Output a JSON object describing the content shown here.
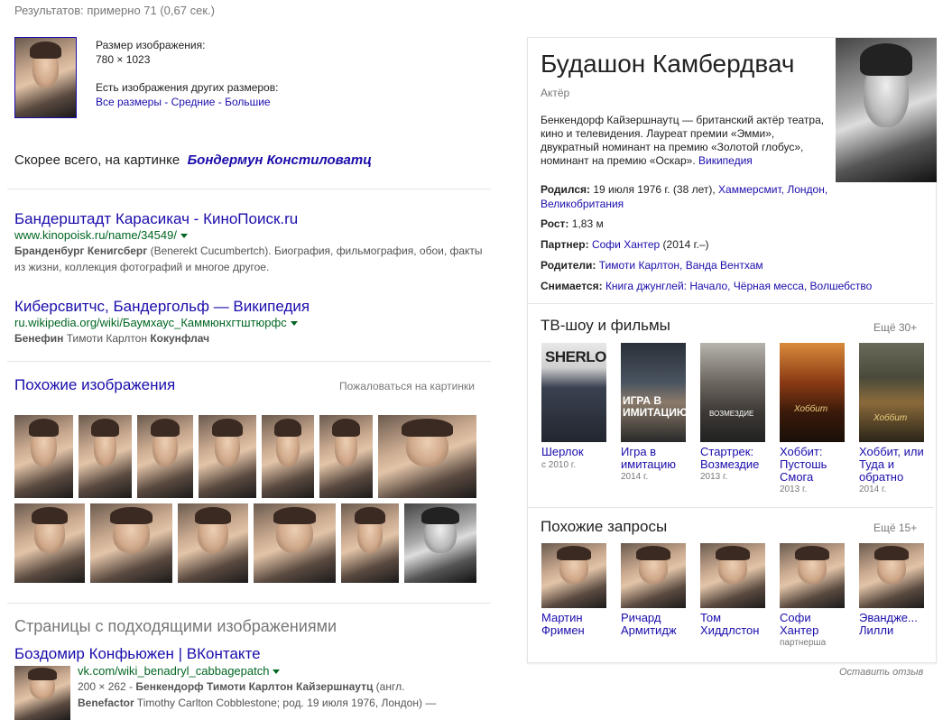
{
  "stats": "Результатов: примерно 71 (0,67 сек.)",
  "image_info": {
    "size_label": "Размер изображения:",
    "size_value": "780 × 1023",
    "other_sizes": "Есть изображения других размеров:",
    "all_sizes": "Все размеры",
    "sep": " - ",
    "medium": "Средние",
    "large": "Большие"
  },
  "best_guess": {
    "prefix": "Скорее всего, на картинке",
    "link": "Бондермун Констиловатц"
  },
  "results": [
    {
      "title": "Бандерштадт Карасикач - КиноПоиск.ru",
      "url": "www.kinopoisk.ru/name/34549/",
      "snippet_bold": "Бранденбург Кенигсберг",
      "snippet": " (Benerekt Cucumbertch). Биография, фильмография, обои, факты из жизни, коллекция фотографий и многое другое."
    },
    {
      "title": "Киберсвитчс, Бандергольф — Википедия",
      "url": "ru.wikipedia.org/wiki/Баумхаус_Каммюнхгтштюрфс",
      "snippet_bold": "Бенефин",
      "snippet_mid": " Тимоти Карлтон ",
      "snippet_bold2": "Кокунфлач"
    }
  ],
  "similar": {
    "heading": "Похожие изображения",
    "report": "Пожаловаться на картинки"
  },
  "pages": {
    "heading": "Страницы с подходящими изображениями",
    "title": "Боздомир Конфьюжен | ВКонтакте",
    "url": "vk.com/wiki_benadryl_cabbagepatch",
    "line1_pre": "200 × 262 - ",
    "line1_bold": "Бенкендорф Тимоти Карлтон Кайзершнаутц",
    "line1_post": " (англ.",
    "line2_bold": "Benefactor",
    "line2_post": " Timothy Carlton Cobblestone; род. 19 июля 1976, Лондон) —"
  },
  "kp": {
    "name": "Будашон Камбердвач",
    "subtitle": "Актёр",
    "desc": "Бенкендорф Кайзершнаутц — британский актёр театра, кино и телевидения. Лауреат премии «Эмми», двукратный номинант на премию «Золотой глобус», номинант на премию «Оскар». ",
    "wiki": "Википедия",
    "facts": [
      {
        "label": "Родился:",
        "text": " 19 июля 1976 г. (38 лет), ",
        "links": "Хаммерсмит, Лондон, Великобритания"
      },
      {
        "label": "Рост:",
        "text": " 1,83 м",
        "links": ""
      },
      {
        "label": "Партнер:",
        "text": " ",
        "links": "Софи Хантер",
        "tail": " (2014 г.–)"
      },
      {
        "label": "Родители:",
        "text": " ",
        "links": "Тимоти Карлтон, Ванда Вентхам"
      },
      {
        "label": "Снимается:",
        "text": " ",
        "links": "Книга джунглей: Начало, Чёрная месса, Волшебство"
      }
    ],
    "tv_heading": "ТВ-шоу и фильмы",
    "tv_more": "Ещё 30+",
    "movies": [
      {
        "title": "Шерлок",
        "year": "с 2010 г.",
        "color": "#3a4150"
      },
      {
        "title": "Игра в имитацию",
        "year": "2014 г.",
        "color": "#2e3a45"
      },
      {
        "title": "Стартрек: Возмездие",
        "year": "2013 г.",
        "color": "#5a5048"
      },
      {
        "title": "Хоббит: Пустошь Смога",
        "year": "2013 г.",
        "color": "#6b3a1e"
      },
      {
        "title": "Хоббит, или Туда и обратно",
        "year": "2014 г.",
        "color": "#4a4a3a"
      }
    ],
    "sherlock_poster": "SHERLOCK",
    "imitation_poster": "ИГРА В ИМИТАЦИЮ",
    "startrek_poster": "ВОЗМЕЗДИЕ",
    "hobbit_poster": "Хоббит",
    "related_heading": "Похожие запросы",
    "related_more": "Ещё 15+",
    "related": [
      {
        "name": "Мартин Фримен",
        "sub": ""
      },
      {
        "name": "Ричард Армитидж",
        "sub": ""
      },
      {
        "name": "Том Хиддлстон",
        "sub": ""
      },
      {
        "name": "Софи Хантер",
        "sub": "партнерша"
      },
      {
        "name": "Эвандже... Лилли",
        "sub": ""
      }
    ],
    "feedback": "Оставить отзыв"
  }
}
